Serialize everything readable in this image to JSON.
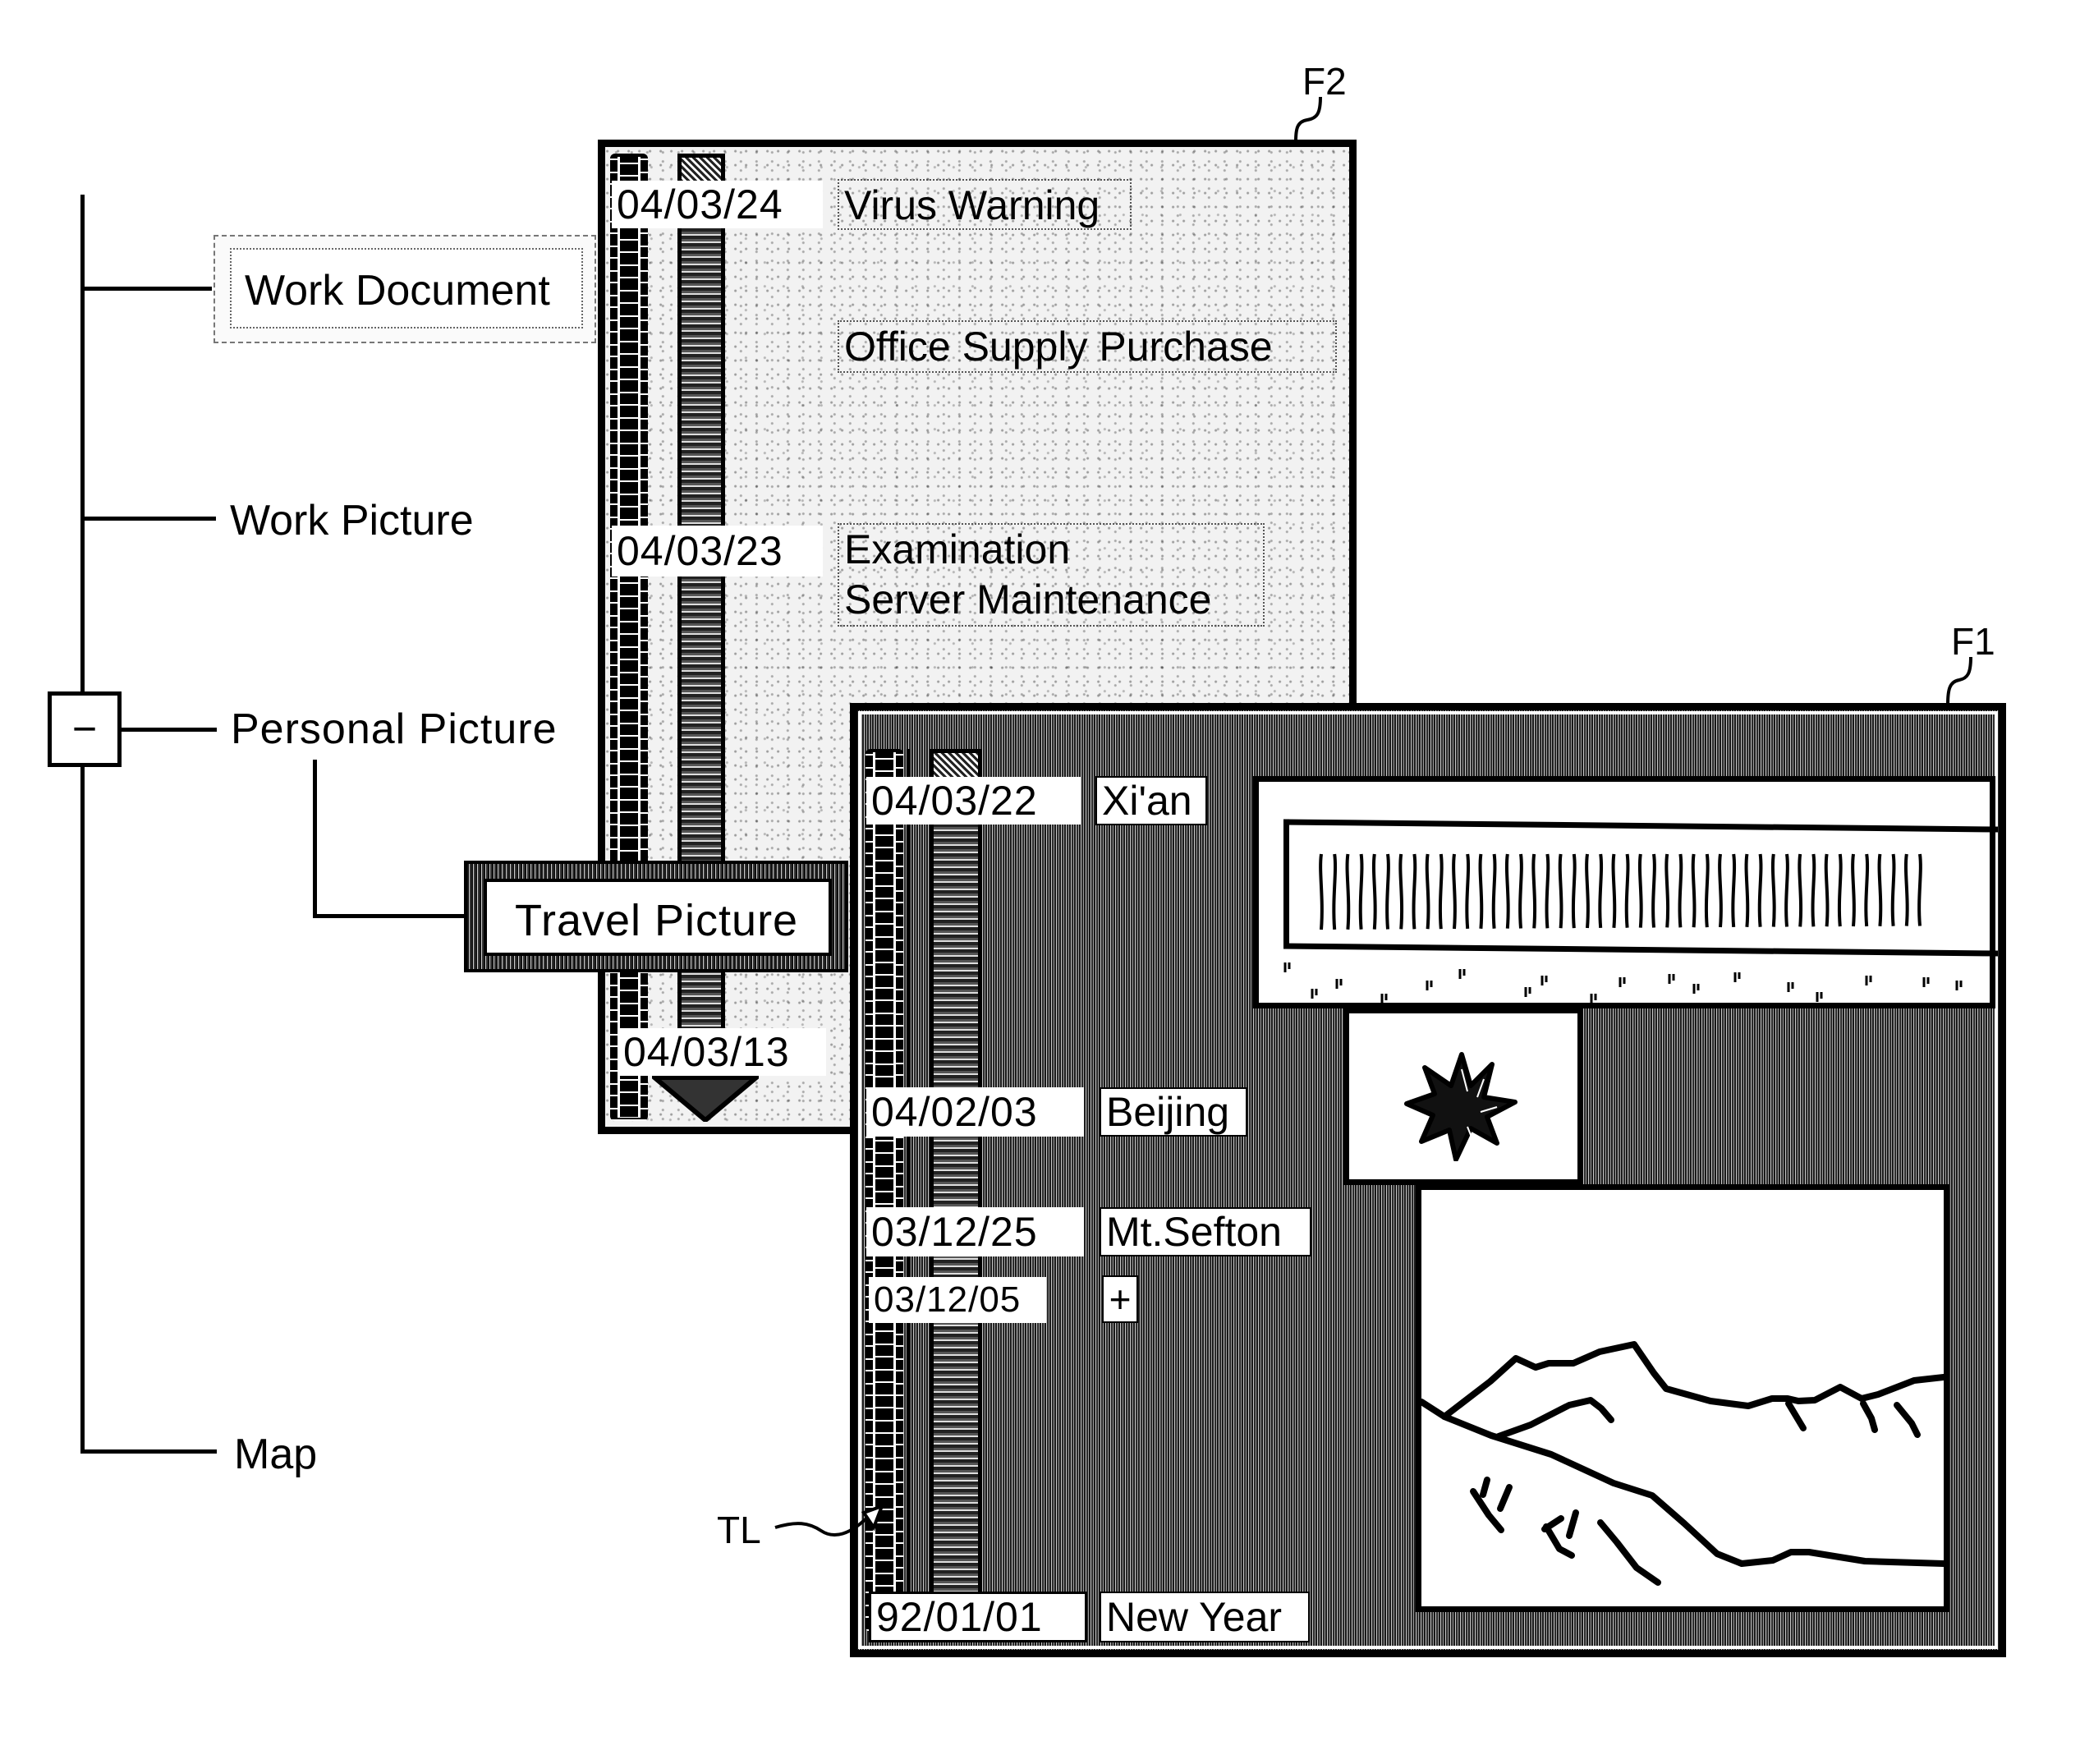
{
  "tree": {
    "collapse_toggle": "−",
    "items": [
      {
        "label": "Work Document",
        "selected": true
      },
      {
        "label": "Work Picture"
      },
      {
        "label": "Personal Picture",
        "expanded": true,
        "children": [
          {
            "label": "Travel Picture",
            "selected": true
          }
        ]
      },
      {
        "label": "Map"
      }
    ]
  },
  "reference_labels": {
    "f2": "F2",
    "f1": "F1",
    "timeline": "TL"
  },
  "window_f2": {
    "folder": "Work Document",
    "entries": [
      {
        "date": "04/03/24",
        "titles": [
          "Virus Warning"
        ]
      },
      {
        "date": "",
        "titles": [
          "Office Supply Purchase"
        ]
      },
      {
        "date": "04/03/23",
        "titles": [
          "Examination",
          "Server Maintenance"
        ]
      },
      {
        "date": "04/03/13",
        "titles": []
      }
    ],
    "scroll_down_icon": "down-triangle-icon"
  },
  "window_f1": {
    "folder": "Travel Picture",
    "entries": [
      {
        "date": "04/03/22",
        "title": "Xi'an"
      },
      {
        "date": "04/02/03",
        "title": "Beijing"
      },
      {
        "date": "03/12/25",
        "title": "Mt.Sefton"
      },
      {
        "date": "03/12/05",
        "title": "+"
      },
      {
        "date": "92/01/01",
        "title": "New Year"
      }
    ],
    "thumbnails": [
      {
        "name": "panorama-gate-picture"
      },
      {
        "name": "flower-picture"
      },
      {
        "name": "mountain-picture"
      }
    ]
  }
}
